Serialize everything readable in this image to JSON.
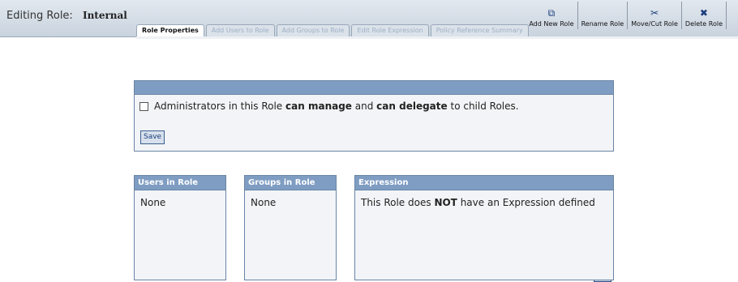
{
  "header": {
    "editing_label": "Editing Role:",
    "role_name": "Internal"
  },
  "toolbar": {
    "add_new_role": "Add New Role",
    "rename_role": "Rename Role",
    "move_cut_role": "Move/Cut Role",
    "delete_role": "Delete Role",
    "add_icon_glyph": "⧉",
    "rename_icon_glyph": "RG",
    "move_icon_glyph": "✂",
    "delete_icon_glyph": "✖"
  },
  "tabs": [
    {
      "label": "Role Properties",
      "active": true
    },
    {
      "label": "Add Users to Role",
      "active": false
    },
    {
      "label": "Add Groups to Role",
      "active": false
    },
    {
      "label": "Edit Role Expression",
      "active": false
    },
    {
      "label": "Policy Reference Summary",
      "active": false
    }
  ],
  "permissions": {
    "text_prefix": "Administrators in this Role",
    "can_manage": "can manage",
    "and": "and",
    "can_delegate": "can delegate",
    "text_suffix": "to child Roles.",
    "checked": false,
    "save_label": "Save"
  },
  "users_box": {
    "header": "Users in Role",
    "value": "None"
  },
  "groups_box": {
    "header": "Groups in Role",
    "value": "None"
  },
  "expression_box": {
    "header": "Expression",
    "text_prefix": "This Role does",
    "text_bold": "NOT",
    "text_suffix": "have an Expression defined"
  },
  "colors": {
    "header_bar": "#7f9dc2",
    "panel_bg": "#f2f4f7",
    "border": "#6a85a6"
  }
}
